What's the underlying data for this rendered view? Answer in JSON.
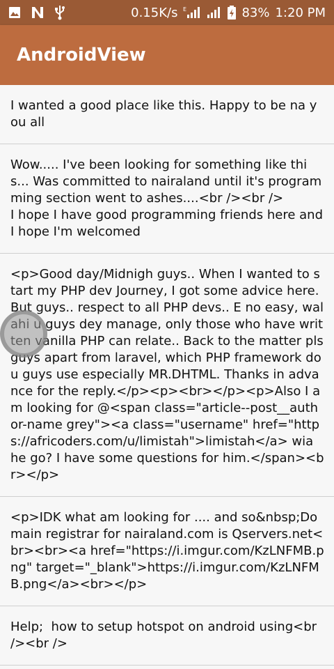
{
  "status_bar": {
    "network_speed": "0.15K/s",
    "battery_percent": "83%",
    "time": "1:20 PM",
    "icons": [
      "gallery-notification-icon",
      "n-notification-icon",
      "usb-icon",
      "signal-e-icon",
      "signal-icon",
      "battery-icon"
    ]
  },
  "app_bar": {
    "title": "AndroidView"
  },
  "list": {
    "items": [
      {
        "text": "I wanted a good place like this. Happy to be na you all"
      },
      {
        "text": "Wow..... I've been looking for something like this... Was committed to nairaland until it's programming section went to ashes....<br /><br />\nI hope I have good programming friends here and I hope I'm welcomed"
      },
      {
        "text": "<p>Good day/Midnigh guys.. When I wanted to start my PHP dev Journey, I got some advice here. But guys.. respect to all PHP devs.. E no easy, walahi u guys dey manage, only those who have written vanilla PHP can relate.. Back to the matter pls guys apart from laravel, which PHP framework do u guys use especially MR.DHTML. Thanks in advance for the reply.</p><p><br></p><p>Also I am looking for @<span class=\"article--post__author-name grey\"><a class=\"username\" href=\"https://africoders.com/u/limistah\">limistah</a> wia he go? I have some questions for him.</span><br></p>"
      },
      {
        "text": "<p>IDK what am looking for .... and so&nbsp;Domain registrar for nairaland.com is Qservers.net<br><br><a href=\"https://i.imgur.com/KzLNFMB.png\" target=\"_blank\">https://i.imgur.com/KzLNFMB.png</a><br></p>"
      },
      {
        "text": "Help;  how to setup hotspot on android using<br /><br />"
      }
    ]
  }
}
